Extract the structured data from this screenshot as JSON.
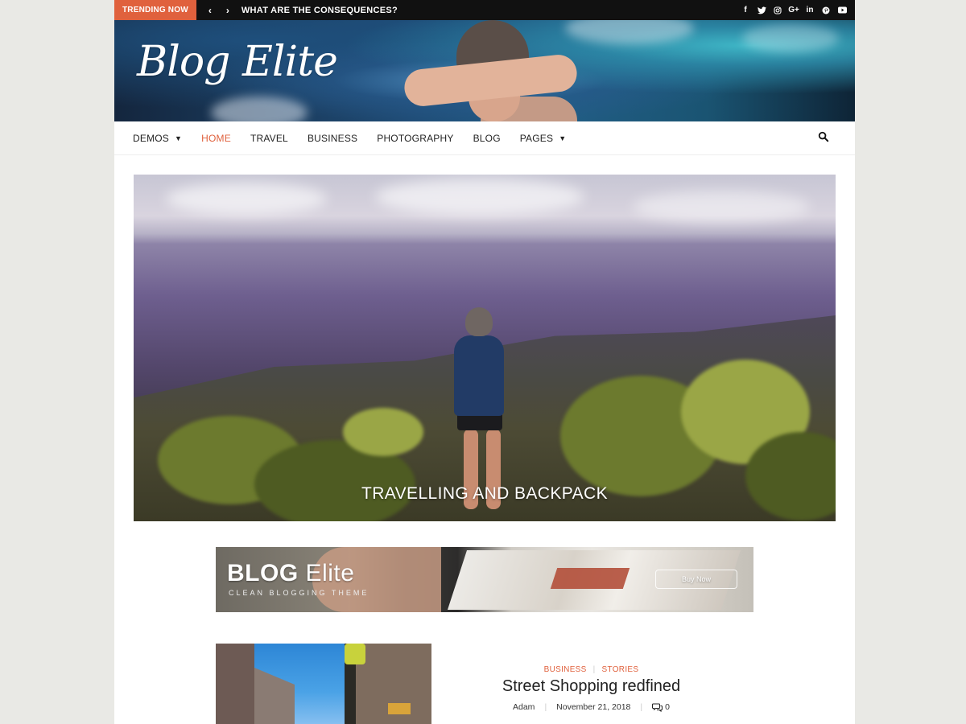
{
  "topbar": {
    "trending_label": "TRENDING NOW",
    "prev_icon": "chevron-left-icon",
    "next_icon": "chevron-right-icon",
    "headline": "WHAT ARE THE CONSEQUENCES?",
    "social_icons": [
      "facebook-icon",
      "twitter-icon",
      "instagram-icon",
      "google-plus-icon",
      "linkedin-icon",
      "pinterest-icon",
      "youtube-icon"
    ],
    "accent": "#e0613d"
  },
  "header": {
    "logo": "Blog Elite"
  },
  "nav": {
    "items": [
      {
        "label": "DEMOS",
        "dropdown": true
      },
      {
        "label": "HOME",
        "active": true
      },
      {
        "label": "TRAVEL"
      },
      {
        "label": "BUSINESS"
      },
      {
        "label": "PHOTOGRAPHY"
      },
      {
        "label": "BLOG"
      },
      {
        "label": "PAGES",
        "dropdown": true
      }
    ],
    "search_icon": "search-icon"
  },
  "hero": {
    "title": "TRAVELLING AND BACKPACK"
  },
  "ad": {
    "title_bold": "BLOG",
    "title_light": "Elite",
    "subtitle": "CLEAN BLOGGING THEME",
    "button": "Buy Now"
  },
  "post": {
    "categories": [
      "BUSINESS",
      "STORIES"
    ],
    "title": "Street Shopping redfined",
    "author": "Adam",
    "date": "November 21, 2018",
    "comments": "0",
    "comment_icon": "comments-icon"
  }
}
